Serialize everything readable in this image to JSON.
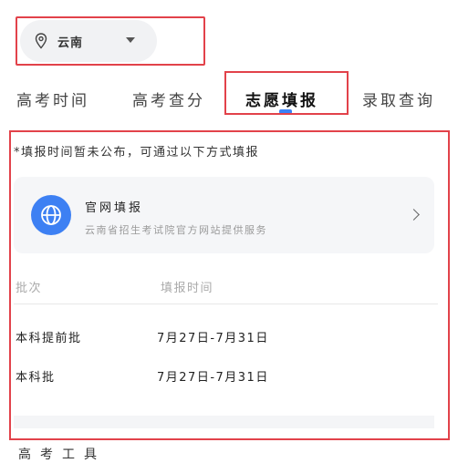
{
  "location": {
    "name": "云南"
  },
  "tabs": [
    {
      "label": "高考时间"
    },
    {
      "label": "高考查分"
    },
    {
      "label": "志愿填报"
    },
    {
      "label": "录取查询"
    }
  ],
  "notice": "*填报时间暂未公布，可通过以下方式填报",
  "card": {
    "title": "官网填报",
    "subtitle": "云南省招生考试院官方网站提供服务"
  },
  "table": {
    "headers": [
      "批次",
      "填报时间"
    ],
    "rows": [
      {
        "batch": "本科提前批",
        "time": "7月27日-7月31日"
      },
      {
        "batch": "本科批",
        "time": "7月27日-7月31日"
      }
    ]
  },
  "footer": {
    "section_title": "高考工具"
  },
  "colors": {
    "accent": "#3d80f3",
    "highlight": "#e2424a"
  }
}
